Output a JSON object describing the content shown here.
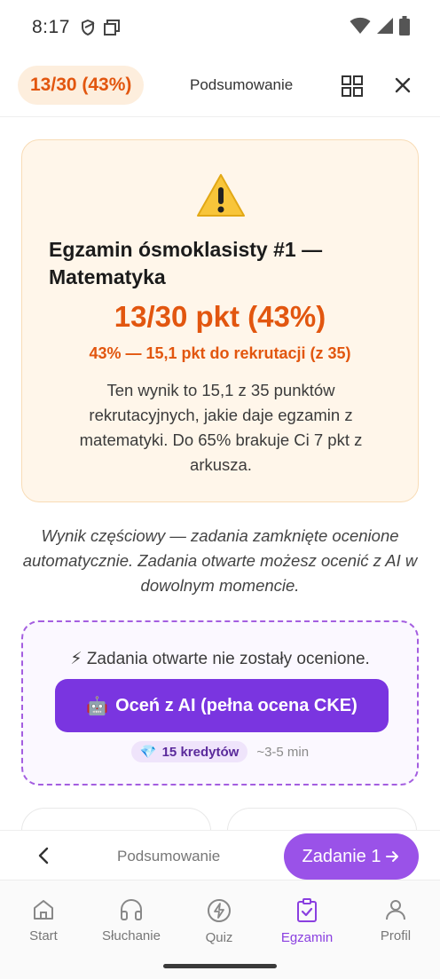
{
  "status_bar": {
    "time": "8:17"
  },
  "header": {
    "score_pill": "13/30 (43%)",
    "summary_label": "Podsumowanie"
  },
  "result": {
    "title": "Egzamin ósmoklasisty #1 — Matematyka",
    "score": "13/30 pkt (43%)",
    "recruitment": "43% — 15,1 pkt do rekrutacji (z 35)",
    "description": "Ten wynik to 15,1 z 35 punktów rekrutacyjnych, jakie daje egzamin z matematyki. Do 65% brakuje Ci 7 pkt z arkusza."
  },
  "partial_note": "Wynik częściowy — zadania zamknięte ocenione automatycznie. Zadania otwarte możesz ocenić z AI w dowolnym momencie.",
  "ai_card": {
    "status": "⚡ Zadania otwarte nie zostały ocenione.",
    "button_label": "Oceń z AI (pełna ocena CKE)",
    "button_emoji": "🤖",
    "credits_emoji": "💎",
    "credits": "15 kredytów",
    "time_estimate": "~3-5 min"
  },
  "exam_nav": {
    "summary_label": "Podsumowanie",
    "next_label": "Zadanie 1"
  },
  "tabbar": {
    "items": [
      {
        "label": "Start",
        "icon": "home-icon"
      },
      {
        "label": "Słuchanie",
        "icon": "headphones-icon"
      },
      {
        "label": "Quiz",
        "icon": "lightning-icon"
      },
      {
        "label": "Egzamin",
        "icon": "exam-check-icon"
      },
      {
        "label": "Profil",
        "icon": "person-icon"
      }
    ],
    "active": "Egzamin"
  },
  "colors": {
    "accent_orange": "#e2560f",
    "accent_purple": "#7a35e0",
    "active_tab": "#8a3fe0"
  }
}
